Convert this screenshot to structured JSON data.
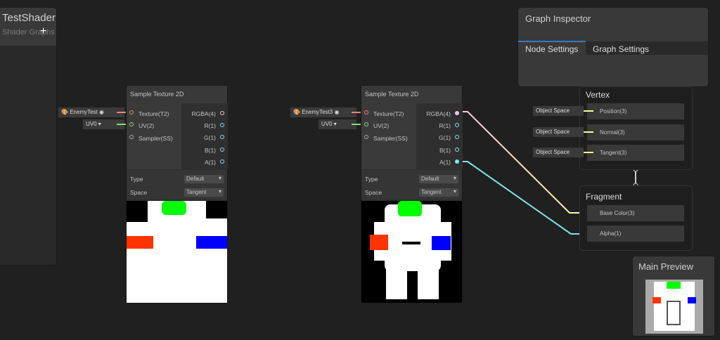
{
  "blackboard": {
    "title": "TestShader",
    "subtitle": "Shader Graphs",
    "add": "+"
  },
  "nodes": [
    {
      "title": "Sample Texture 2D",
      "texture_property": "EnemyTest",
      "uv_value": "UV0",
      "inputs": [
        "Texture(T2)",
        "UV(2)",
        "Sampler(SS)"
      ],
      "outputs": [
        "RGBA(4)",
        "R(1)",
        "G(1)",
        "B(1)",
        "A(1)"
      ],
      "type_label": "Type",
      "type_value": "Default",
      "space_label": "Space",
      "space_value": "Tangent"
    },
    {
      "title": "Sample Texture 2D",
      "texture_property": "EnemyTest3",
      "uv_value": "UV0",
      "inputs": [
        "Texture(T2)",
        "UV(2)",
        "Sampler(SS)"
      ],
      "outputs": [
        "RGBA(4)",
        "R(1)",
        "G(1)",
        "B(1)",
        "A(1)"
      ],
      "type_label": "Type",
      "type_value": "Default",
      "space_label": "Space",
      "space_value": "Tangent"
    }
  ],
  "inspector": {
    "title": "Graph Inspector",
    "tabs": [
      "Node Settings",
      "Graph Settings"
    ],
    "active_tab": 0
  },
  "vertex": {
    "title": "Vertex",
    "slots": [
      {
        "label": "Position(3)",
        "input": "Object Space"
      },
      {
        "label": "Normal(3)",
        "input": "Object Space"
      },
      {
        "label": "Tangent(3)",
        "input": "Object Space"
      }
    ]
  },
  "fragment": {
    "title": "Fragment",
    "slots": [
      "Base Color(3)",
      "Alpha(1)"
    ]
  },
  "main_preview": {
    "title": "Main Preview"
  },
  "colors": {
    "texture": "#f08080",
    "uv": "#84e06e",
    "vector4": "#f2c6e8",
    "vector3": "#f6ff9a",
    "float": "#84e4e7",
    "accent": "#3a79bb"
  }
}
